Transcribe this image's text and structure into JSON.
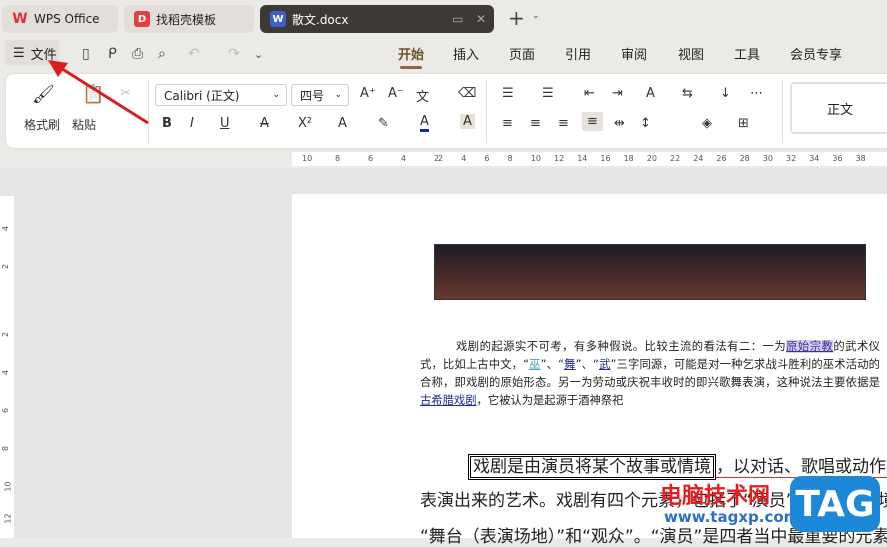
{
  "tabs": [
    {
      "label": "WPS Office",
      "icon": "wps-logo-icon"
    },
    {
      "label": "找稻壳模板",
      "icon": "docer-icon"
    },
    {
      "label": "散文.docx",
      "icon": "word-doc-icon"
    }
  ],
  "toolbar": {
    "file_label": "文件"
  },
  "menu": [
    "开始",
    "插入",
    "页面",
    "引用",
    "审阅",
    "视图",
    "工具",
    "会员专享"
  ],
  "ribbon": {
    "format_painter": "格式刷",
    "paste": "粘贴",
    "font": "Calibri (正文)",
    "size": "四号",
    "style": "正文"
  },
  "ruler": {
    "left": [
      "10",
      "8",
      "6",
      "4",
      "2"
    ],
    "right": [
      "2",
      "4",
      "6",
      "8",
      "10",
      "12",
      "14",
      "16",
      "18",
      "20",
      "22",
      "24",
      "26",
      "28",
      "30",
      "32",
      "34",
      "36",
      "38"
    ],
    "vertical": [
      "4",
      "2",
      "2",
      "4",
      "6",
      "8",
      "10",
      "12"
    ]
  },
  "doc": {
    "p1": [
      "戏剧的起源实不可考，有多种假说。比较主流的看法有二：一为",
      "原始宗教",
      "的武术仪式，比如上古中文，“",
      "巫",
      "”、“",
      "舞",
      "”、“",
      "武",
      "”三字同源，可能是对一种乞求战斗胜利的巫术活动的合称，即戏剧的原始形态。另一为劳动或庆祝丰收时的即兴歌舞表演，这种说法主要依据是",
      "古希腊戏剧",
      "，它被认为是起源于酒神祭祀"
    ],
    "l1a": "戏剧是由演员将某个故事或情境",
    "l1b": "，以对话、歌唱或动作式",
    "l2": "表演出来的艺术。戏剧有四个元素，包括了“演员”、“故事(情境)”、",
    "l3": "“舞台（表演场地）”和“观众”。“演员”是四者当中最重要的元素"
  },
  "watermark": {
    "site": "电脑技术网",
    "url": "www.tagxp.com",
    "tag": "TAG"
  }
}
